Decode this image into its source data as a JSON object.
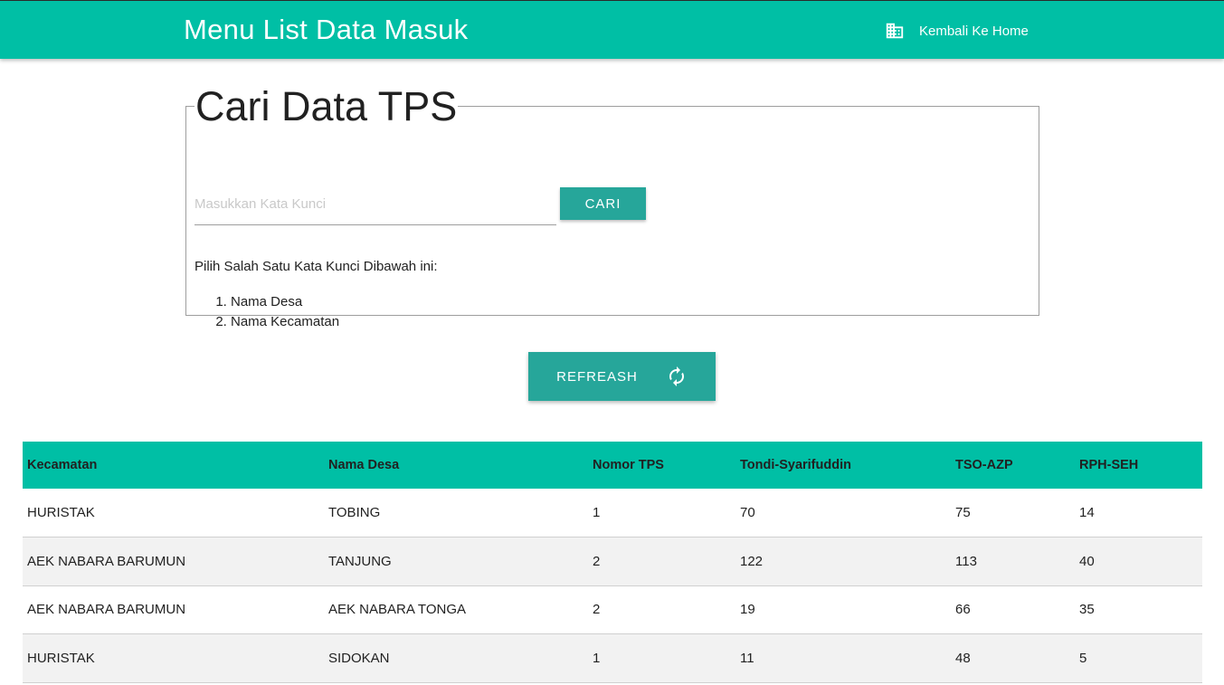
{
  "navbar": {
    "brand": "Menu List Data Masuk",
    "home_icon": "building-icon",
    "home_label": "Kembali Ke Home",
    "bg_color": "#00bfa5"
  },
  "search": {
    "legend": "Cari Data TPS",
    "placeholder": "Masukkan Kata Kunci",
    "value": "",
    "button_label": "CARI",
    "hint": "Pilih Salah Satu Kata Kunci Dibawah ini:",
    "keywords": [
      "Nama Desa",
      "Nama Kecamatan"
    ]
  },
  "refresh": {
    "label": "REFREASH",
    "icon": "refresh-icon",
    "color": "#26a69a"
  },
  "table": {
    "headers": [
      "Kecamatan",
      "Nama Desa",
      "Nomor TPS",
      "Tondi-Syarifuddin",
      "TSO-AZP",
      "RPH-SEH"
    ],
    "rows": [
      [
        "HURISTAK",
        "TOBING",
        "1",
        "70",
        "75",
        "14"
      ],
      [
        "AEK NABARA BARUMUN",
        "TANJUNG",
        "2",
        "122",
        "113",
        "40"
      ],
      [
        "AEK NABARA BARUMUN",
        "AEK NABARA TONGA",
        "2",
        "19",
        "66",
        "35"
      ],
      [
        "HURISTAK",
        "SIDOKAN",
        "1",
        "11",
        "48",
        "5"
      ]
    ]
  }
}
